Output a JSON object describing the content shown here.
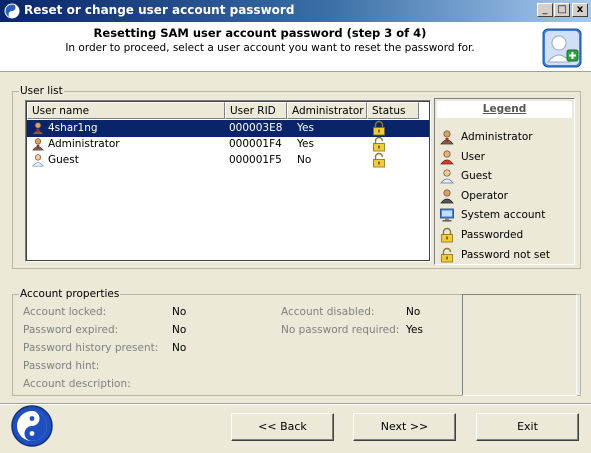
{
  "window": {
    "title": "Reset or change user account password",
    "controls": {
      "minimize": "_",
      "maximize": "□",
      "close": "x"
    }
  },
  "header": {
    "title": "Resetting SAM user account password (step 3 of 4)",
    "subtitle": "In order to proceed, select a user account you want to reset the password for.",
    "icon": "user-add-icon"
  },
  "user_list": {
    "group_label": "User list",
    "columns": [
      "User name",
      "User RID",
      "Administrator",
      "Status"
    ],
    "rows": [
      {
        "name": "4shar1ng",
        "rid": "000003E8",
        "admin": "Yes",
        "type": "administrator",
        "status": "passworded",
        "selected": true
      },
      {
        "name": "Administrator",
        "rid": "000001F4",
        "admin": "Yes",
        "type": "administrator",
        "status": "password-not-set",
        "selected": false
      },
      {
        "name": "Guest",
        "rid": "000001F5",
        "admin": "No",
        "type": "guest",
        "status": "password-not-set",
        "selected": false
      }
    ]
  },
  "legend": {
    "title": "Legend",
    "items": [
      {
        "label": "Administrator",
        "icon": "administrator-icon"
      },
      {
        "label": "User",
        "icon": "user-icon"
      },
      {
        "label": "Guest",
        "icon": "guest-icon"
      },
      {
        "label": "Operator",
        "icon": "operator-icon"
      },
      {
        "label": "System account",
        "icon": "system-account-icon"
      },
      {
        "label": "Passworded",
        "icon": "passworded-icon"
      },
      {
        "label": "Password not set",
        "icon": "password-not-set-icon"
      }
    ]
  },
  "account_properties": {
    "group_label": "Account properties",
    "left": [
      {
        "label": "Account locked:",
        "value": "No"
      },
      {
        "label": "Password expired:",
        "value": "No"
      },
      {
        "label": "Password history present:",
        "value": "No"
      },
      {
        "label": "Password hint:",
        "value": ""
      },
      {
        "label": "Account description:",
        "value": ""
      }
    ],
    "right": [
      {
        "label": "Account disabled:",
        "value": "No"
      },
      {
        "label": "No password required:",
        "value": "Yes"
      }
    ]
  },
  "buttons": {
    "back": "<< Back",
    "next": "Next >>",
    "exit": "Exit"
  },
  "colors": {
    "titlebar_start": "#0a246a",
    "titlebar_end": "#a6caf0",
    "selection": "#0a246a",
    "window_bg": "#ece9d8"
  }
}
